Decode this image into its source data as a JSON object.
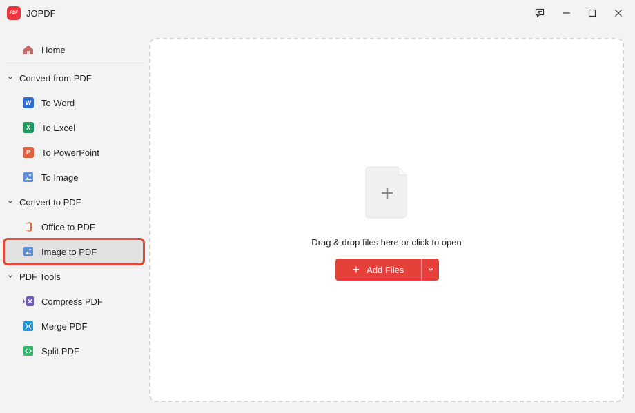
{
  "window": {
    "title": "JOPDF",
    "logo_text": "PDF"
  },
  "sidebar": {
    "home": {
      "label": "Home",
      "icon": "home-icon"
    },
    "sections": [
      {
        "label": "Convert from PDF",
        "items": [
          {
            "label": "To Word",
            "icon": "word-icon",
            "badge": "W",
            "color": "#2b6fd6"
          },
          {
            "label": "To Excel",
            "icon": "excel-icon",
            "badge": "X",
            "color": "#1e9b5c"
          },
          {
            "label": "To PowerPoint",
            "icon": "powerpoint-icon",
            "badge": "P",
            "color": "#e2613f"
          },
          {
            "label": "To Image",
            "icon": "image-icon",
            "color": "#5b8fd9"
          }
        ]
      },
      {
        "label": "Convert to PDF",
        "items": [
          {
            "label": "Office to PDF",
            "icon": "office-icon",
            "color": "#e8672b"
          },
          {
            "label": "Image to PDF",
            "icon": "image-icon",
            "color": "#5b8fd9",
            "selected": true
          }
        ]
      },
      {
        "label": "PDF Tools",
        "items": [
          {
            "label": "Compress PDF",
            "icon": "compress-icon",
            "color": "#6b5bb5"
          },
          {
            "label": "Merge PDF",
            "icon": "merge-icon",
            "color": "#1b93d6"
          },
          {
            "label": "Split PDF",
            "icon": "split-icon",
            "color": "#2fb86a"
          }
        ]
      }
    ]
  },
  "main": {
    "drop_text": "Drag & drop files here or click to open",
    "add_files_label": "Add Files"
  },
  "colors": {
    "accent": "#e5403a",
    "selection_outline": "#e04a3b"
  }
}
